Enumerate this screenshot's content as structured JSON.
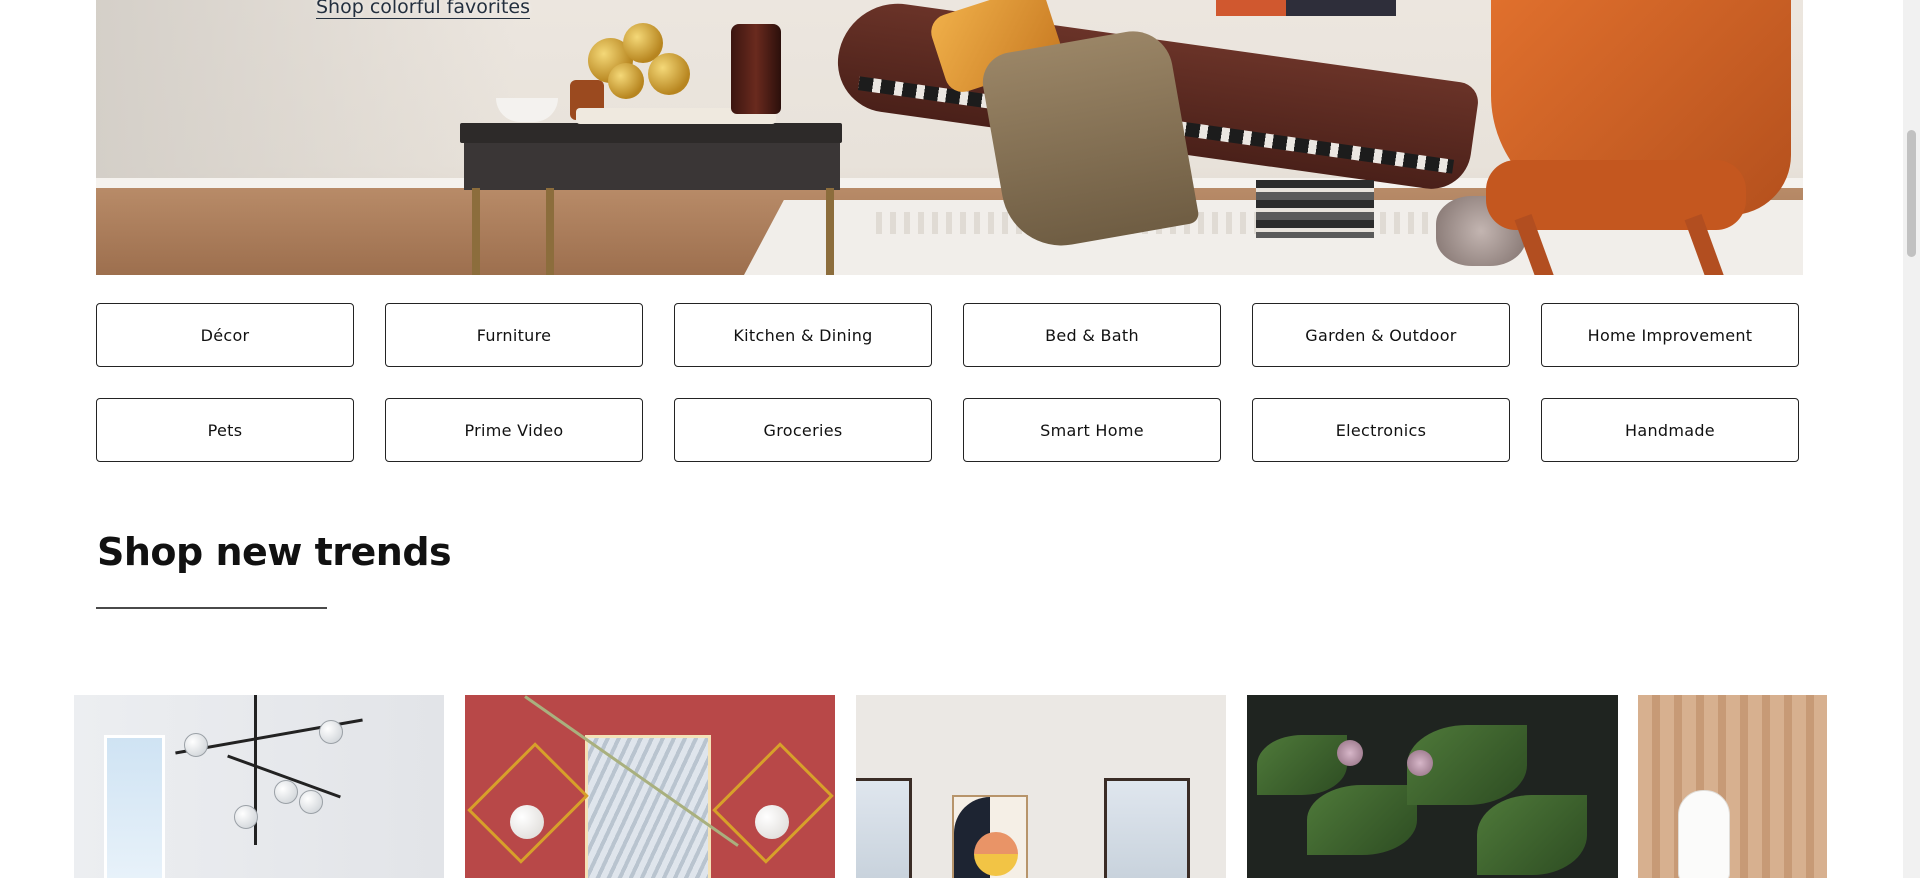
{
  "hero": {
    "link_text": "Shop colorful favorites"
  },
  "categories": [
    {
      "label": "Décor"
    },
    {
      "label": "Furniture"
    },
    {
      "label": "Kitchen & Dining"
    },
    {
      "label": "Bed & Bath"
    },
    {
      "label": "Garden & Outdoor"
    },
    {
      "label": "Home Improvement"
    },
    {
      "label": "Pets"
    },
    {
      "label": "Prime Video"
    },
    {
      "label": "Groceries"
    },
    {
      "label": "Smart Home"
    },
    {
      "label": "Electronics"
    },
    {
      "label": "Handmade"
    }
  ],
  "section": {
    "title": "Shop new trends"
  },
  "colors": {
    "text": "#0f1111",
    "button_border": "#232323",
    "link": "#232f3e"
  }
}
